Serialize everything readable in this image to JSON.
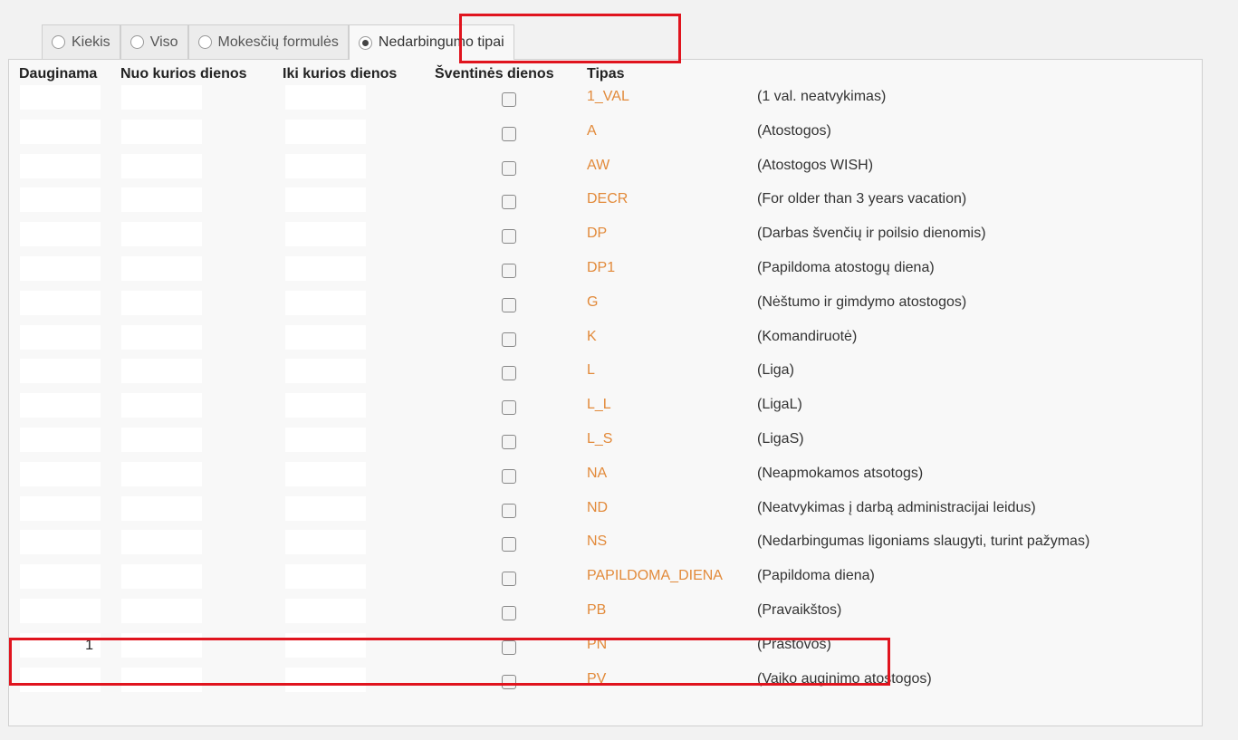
{
  "tabs": [
    {
      "label": "Kiekis",
      "checked": false
    },
    {
      "label": "Viso",
      "checked": false
    },
    {
      "label": "Mokesčių formulės",
      "checked": false
    },
    {
      "label": "Nedarbingumo tipai",
      "checked": true
    }
  ],
  "columns": {
    "multiply": "Dauginama",
    "from_day": "Nuo kurios dienos",
    "to_day": "Iki kurios dienos",
    "holidays": "Šventinės dienos",
    "type": "Tipas"
  },
  "rows": [
    {
      "multiply": "",
      "code": "1_VAL",
      "description": "(1 val. neatvykimas)"
    },
    {
      "multiply": "",
      "code": "A",
      "description": "(Atostogos)"
    },
    {
      "multiply": "",
      "code": "AW",
      "description": "(Atostogos WISH)"
    },
    {
      "multiply": "",
      "code": "DECR",
      "description": "(For older than 3 years vacation)"
    },
    {
      "multiply": "",
      "code": "DP",
      "description": "(Darbas švenčių ir poilsio dienomis)"
    },
    {
      "multiply": "",
      "code": "DP1",
      "description": "(Papildoma atostogų diena)"
    },
    {
      "multiply": "",
      "code": "G",
      "description": "(Nėštumo ir gimdymo atostogos)"
    },
    {
      "multiply": "",
      "code": "K",
      "description": "(Komandiruotė)"
    },
    {
      "multiply": "",
      "code": "L",
      "description": "(Liga)"
    },
    {
      "multiply": "",
      "code": "L_L",
      "description": "(LigaL)"
    },
    {
      "multiply": "",
      "code": "L_S",
      "description": "(LigaS)"
    },
    {
      "multiply": "",
      "code": "NA",
      "description": "(Neapmokamos atsotogs)"
    },
    {
      "multiply": "",
      "code": "ND",
      "description": "(Neatvykimas į darbą administracijai leidus)"
    },
    {
      "multiply": "",
      "code": "NS",
      "description": "(Nedarbingumas ligoniams slaugyti, turint pažymas)"
    },
    {
      "multiply": "",
      "code": "PAPILDOMA_DIENA",
      "description": "(Papildoma diena)"
    },
    {
      "multiply": "",
      "code": "PB",
      "description": "(Pravaikštos)"
    },
    {
      "multiply": "1",
      "code": "PN",
      "description": "(Prastovos)"
    },
    {
      "multiply": "",
      "code": "PV",
      "description": "(Vaiko auginimo atostogos)"
    }
  ],
  "colors": {
    "highlight": "#e0141e",
    "code_text": "#e28a3a"
  }
}
